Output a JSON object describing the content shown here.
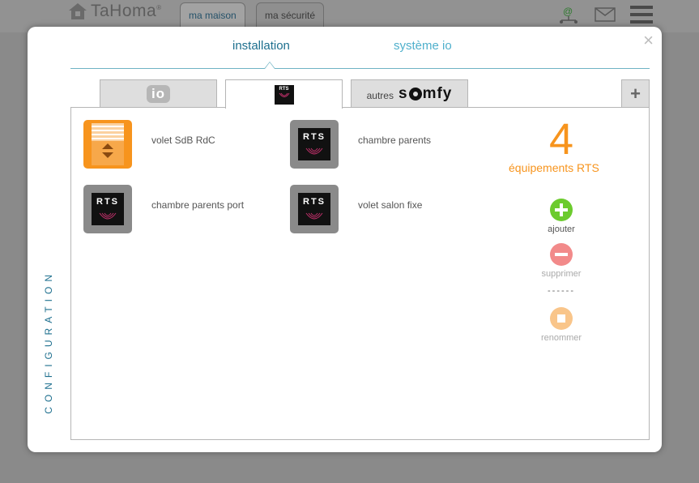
{
  "app": {
    "logo_text": "TaHoma",
    "logo_reg": "®",
    "top_tabs": [
      "ma maison",
      "ma sécurité"
    ]
  },
  "modal": {
    "close_symbol": "×",
    "tabs": {
      "installation": "installation",
      "systeme_io": "système io"
    },
    "side_label": "CONFIGURATION",
    "protocol_tabs": {
      "io": "io",
      "rts_icon": "RTS",
      "autres": "autres",
      "somfy_s": "s",
      "somfy_rest": "mfy",
      "add": "+"
    },
    "devices": [
      {
        "label": "volet SdB RdC",
        "icon": "shutter-icon",
        "color": "#f7941d"
      },
      {
        "label": "chambre parents",
        "icon": "rts-icon",
        "color": "#8a8a8a"
      },
      {
        "label": "chambre parents port",
        "icon": "rts-icon",
        "color": "#8a8a8a"
      },
      {
        "label": "volet salon fixe",
        "icon": "rts-icon",
        "color": "#8a8a8a"
      }
    ],
    "rts_text": "RTS",
    "summary": {
      "count": "4",
      "label": "équipements RTS"
    },
    "actions": {
      "add": {
        "label": "ajouter",
        "color": "#6ccb2e"
      },
      "delete": {
        "label": "supprimer",
        "color": "#f28a8a"
      },
      "separator": "------",
      "rename": {
        "label": "renommer",
        "color": "#f9c58a"
      }
    }
  }
}
